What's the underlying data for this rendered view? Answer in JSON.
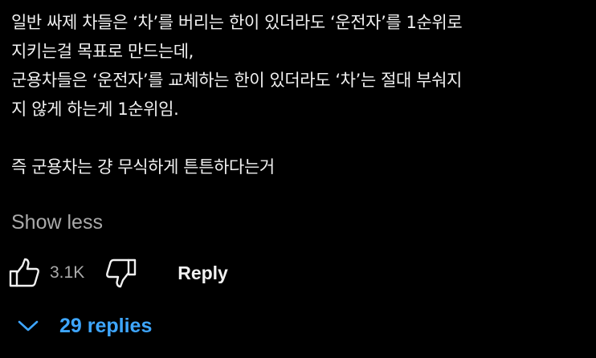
{
  "comment": {
    "lines": [
      "일반 싸제 차들은 ‘차’를 버리는 한이 있더라도 ‘운전자’를 1순위로",
      "지키는걸 목표로 만드는데,",
      "군용차들은 ‘운전자’를 교체하는 한이 있더라도 ‘차’는 절대 부숴지",
      "지 않게 하는게 1순위임.",
      "",
      "즉 군용차는 걍 무식하게 튼튼하다는거"
    ]
  },
  "show_less_label": "Show less",
  "actions": {
    "like_icon": "thumbs-up-icon",
    "like_count": "3.1K",
    "dislike_icon": "thumbs-down-icon",
    "reply_label": "Reply"
  },
  "replies": {
    "toggle_icon": "chevron-down-icon",
    "label": "29 replies"
  },
  "colors": {
    "background": "#000000",
    "text": "#f1f1f1",
    "secondary_text": "#aaaaaa",
    "link": "#3ea6ff"
  }
}
